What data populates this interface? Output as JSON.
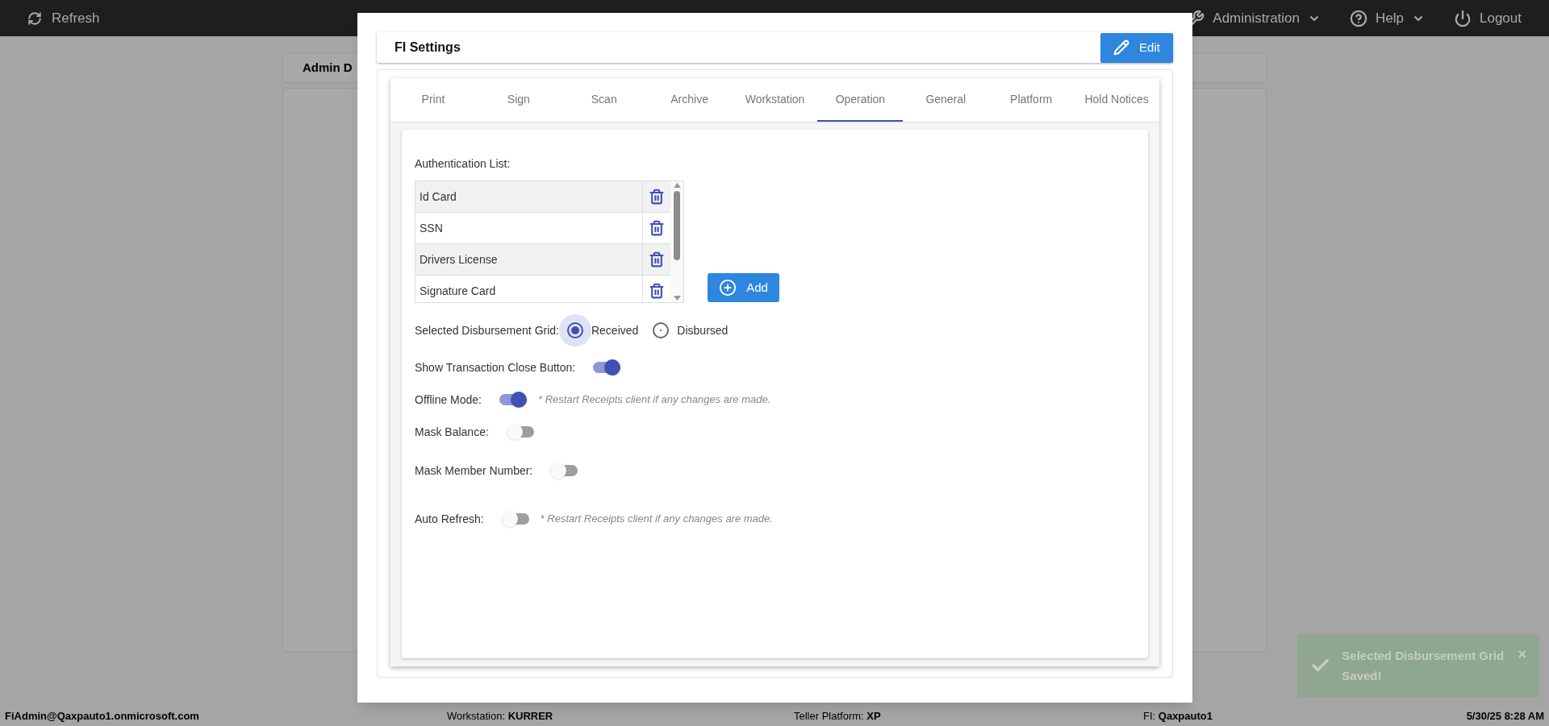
{
  "top_bar": {
    "refresh": "Refresh",
    "menus": [
      {
        "label": "Administration",
        "kind": "wrench",
        "dropdown": true
      },
      {
        "label": "Help",
        "kind": "help",
        "dropdown": true
      },
      {
        "label": "Logout",
        "kind": "power",
        "dropdown": false
      }
    ]
  },
  "background": {
    "card_title": "Admin D"
  },
  "modal": {
    "title": "FI Settings",
    "edit_button": "Edit",
    "tabs": [
      {
        "label": "Print",
        "selected": false
      },
      {
        "label": "Sign",
        "selected": false
      },
      {
        "label": "Scan",
        "selected": false
      },
      {
        "label": "Archive",
        "selected": false
      },
      {
        "label": "Workstation",
        "selected": false
      },
      {
        "label": "Operation",
        "selected": true
      },
      {
        "label": "General",
        "selected": false
      },
      {
        "label": "Platform",
        "selected": false
      },
      {
        "label": "Hold Notices",
        "selected": false
      }
    ],
    "auth_label": "Authentication List:",
    "auth_list": [
      "Id Card",
      "SSN",
      "Drivers License",
      "Signature Card"
    ],
    "add_button": "Add",
    "disbursement": {
      "label": "Selected Disbursement Grid:",
      "options": [
        {
          "label": "Received",
          "selected": true
        },
        {
          "label": "Disbursed",
          "selected": false
        }
      ]
    },
    "toggles": [
      {
        "label": "Show Transaction Close Button:",
        "on": true
      },
      {
        "label": "Offline Mode:",
        "on": true,
        "note": "* Restart Receipts client if any changes are made."
      },
      {
        "label": "Mask Balance:",
        "on": false
      },
      {
        "label": "Mask Member Number:",
        "on": false
      },
      {
        "label": "Auto Refresh:",
        "on": false,
        "note": "* Restart Receipts client if any changes are made."
      }
    ]
  },
  "status_bar": {
    "user": "FiAdmin@Qaxpauto1.onmicrosoft.com",
    "fields": [
      {
        "label": "Workstation:",
        "value": "KURRER"
      },
      {
        "label": "Teller Platform:",
        "value": "XP"
      },
      {
        "label": "FI:",
        "value": "Qaxpauto1"
      }
    ],
    "datetime": "5/30/25 8:28 AM"
  },
  "toast": {
    "message": "Selected Disbursement Grid Saved!",
    "close": "×"
  }
}
